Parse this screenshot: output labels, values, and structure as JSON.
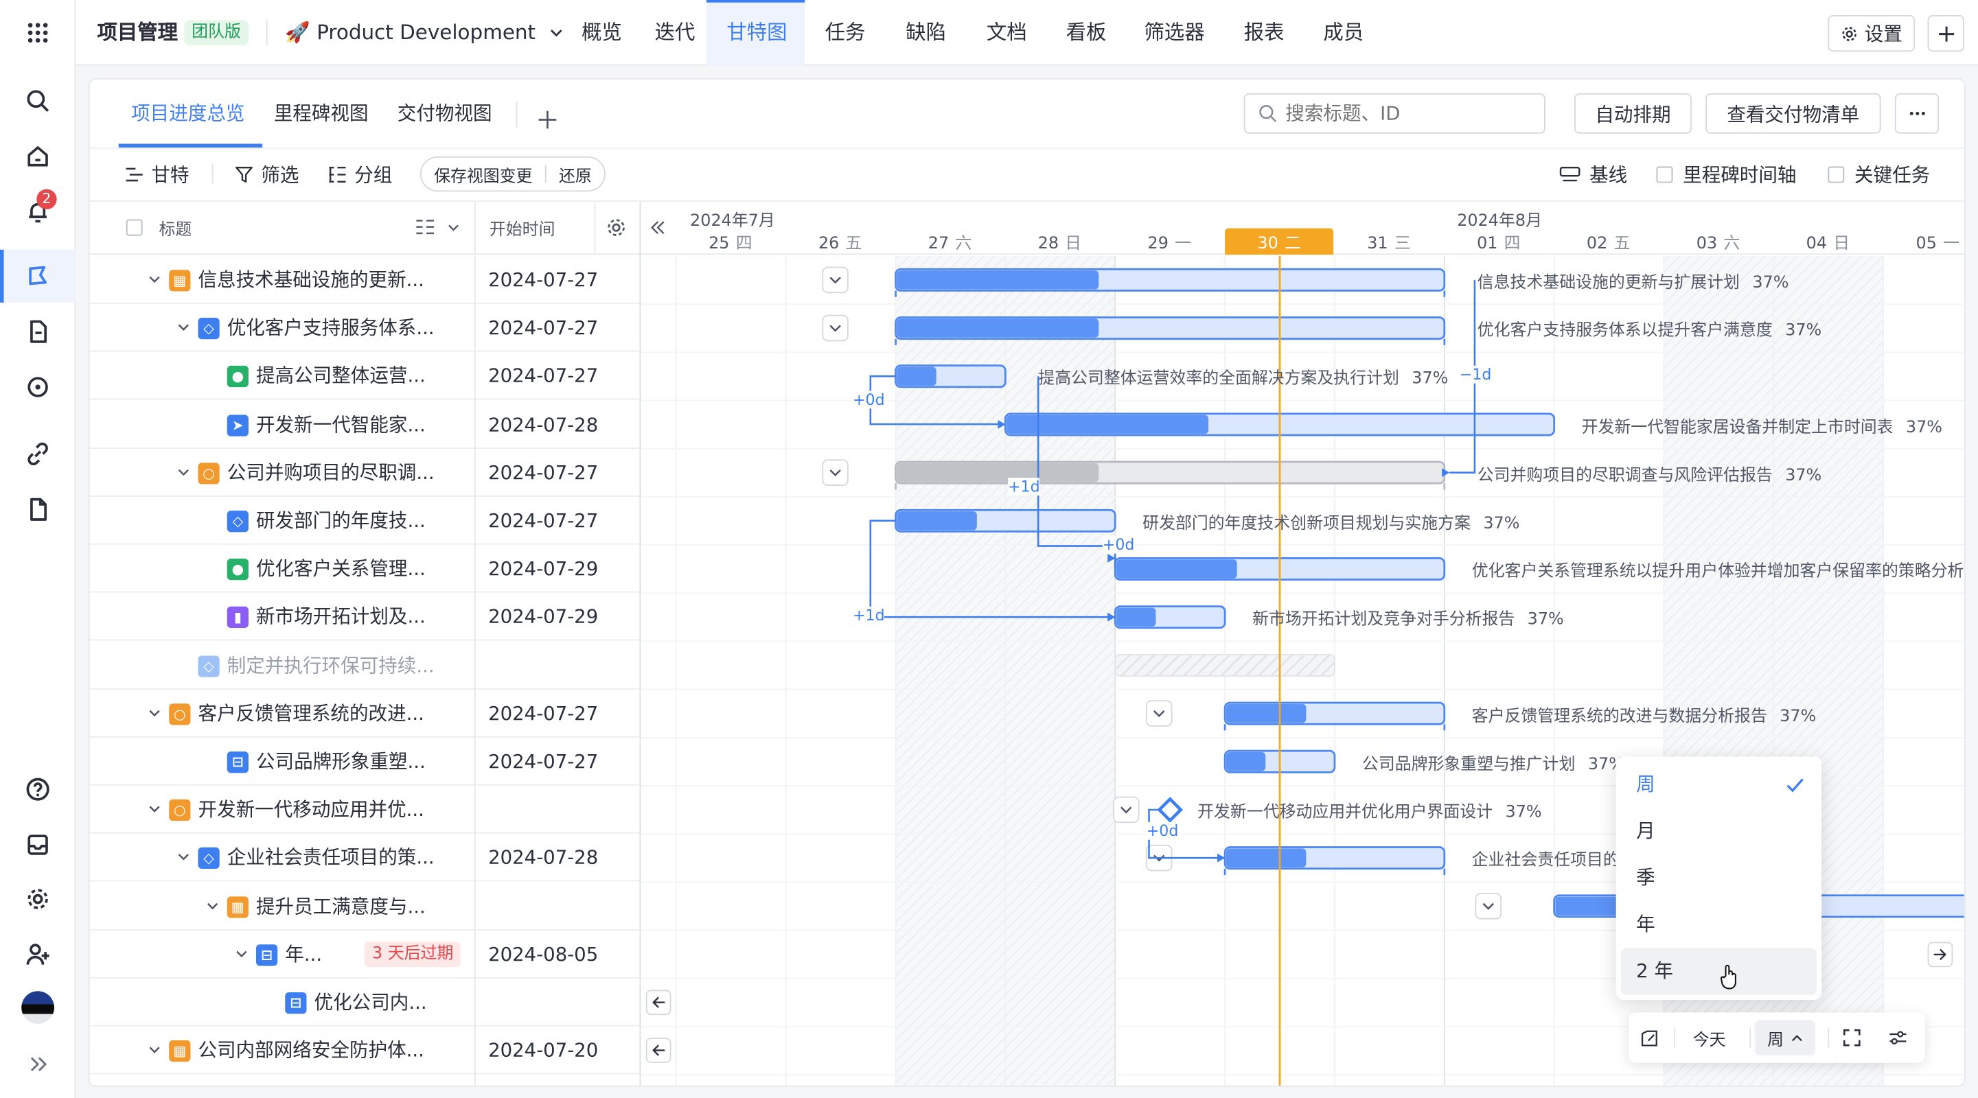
{
  "topbar": {
    "project_label": "项目管理",
    "edition_badge": "团队版",
    "project_name": "🚀 Product Development",
    "nav": [
      "概览",
      "迭代",
      "甘特图",
      "任务",
      "缺陷",
      "文档",
      "看板",
      "筛选器",
      "报表",
      "成员"
    ],
    "active_nav": "甘特图",
    "settings_label": "设置"
  },
  "rail": {
    "notification_count": "2"
  },
  "views": {
    "tabs": [
      "项目进度总览",
      "里程碑视图",
      "交付物视图"
    ],
    "active": "项目进度总览",
    "search_placeholder": "搜索标题、ID",
    "auto_schedule": "自动排期",
    "view_deliverables": "查看交付物清单"
  },
  "toolbar": {
    "gantt": "甘特",
    "filter": "筛选",
    "group": "分组",
    "save_view": "保存视图变更",
    "restore": "还原",
    "baseline": "基线",
    "milestone_axis": "里程碑时间轴",
    "critical_task": "关键任务"
  },
  "columns": {
    "title": "标题",
    "start": "开始时间"
  },
  "timeline": {
    "month1": "2024年7月",
    "month2": "2024年8月",
    "days": [
      {
        "d": "25",
        "w": "四"
      },
      {
        "d": "26",
        "w": "五"
      },
      {
        "d": "27",
        "w": "六"
      },
      {
        "d": "28",
        "w": "日"
      },
      {
        "d": "29",
        "w": "一"
      },
      {
        "d": "30",
        "w": "二"
      },
      {
        "d": "31",
        "w": "三"
      },
      {
        "d": "01",
        "w": "四"
      },
      {
        "d": "02",
        "w": "五"
      },
      {
        "d": "03",
        "w": "六"
      },
      {
        "d": "04",
        "w": "日"
      },
      {
        "d": "05",
        "w": "一"
      }
    ],
    "today_index": 5
  },
  "rows": [
    {
      "title": "信息技术基础设施的更新...",
      "date": "2024-07-27",
      "level": 0,
      "icon": "epic",
      "color": "#f29a2e",
      "expand": true
    },
    {
      "title": "优化客户支持服务体系...",
      "date": "2024-07-27",
      "level": 1,
      "icon": "feature",
      "color": "#3d7ef0",
      "expand": true
    },
    {
      "title": "提高公司整体运营...",
      "date": "2024-07-27",
      "level": 2,
      "icon": "user-story",
      "color": "#27b26a",
      "expand": false
    },
    {
      "title": "开发新一代智能家...",
      "date": "2024-07-28",
      "level": 2,
      "icon": "task",
      "color": "#3d7ef0",
      "expand": false
    },
    {
      "title": "公司并购项目的尽职调...",
      "date": "2024-07-27",
      "level": 1,
      "icon": "idea",
      "color": "#f29a2e",
      "expand": true
    },
    {
      "title": "研发部门的年度技...",
      "date": "2024-07-27",
      "level": 2,
      "icon": "feature",
      "color": "#3d7ef0",
      "expand": false
    },
    {
      "title": "优化客户关系管理...",
      "date": "2024-07-29",
      "level": 2,
      "icon": "user-story",
      "color": "#27b26a",
      "expand": false
    },
    {
      "title": "新市场开拓计划及...",
      "date": "2024-07-29",
      "level": 2,
      "icon": "bookmark",
      "color": "#8b5cf6",
      "expand": false
    },
    {
      "title": "制定并执行环保可持续...",
      "date": "",
      "level": 1,
      "icon": "feature",
      "color": "#9ec1f7",
      "expand": false,
      "muted": true
    },
    {
      "title": "客户反馈管理系统的改进...",
      "date": "2024-07-27",
      "level": 0,
      "icon": "idea",
      "color": "#f29a2e",
      "expand": true
    },
    {
      "title": "公司品牌形象重塑...",
      "date": "2024-07-27",
      "level": 2,
      "icon": "sub-task",
      "color": "#3d7ef0",
      "expand": false
    },
    {
      "title": "开发新一代移动应用并优...",
      "date": "",
      "level": 0,
      "icon": "idea",
      "color": "#f29a2e",
      "expand": true
    },
    {
      "title": "企业社会责任项目的策...",
      "date": "2024-07-28",
      "level": 1,
      "icon": "feature",
      "color": "#3d7ef0",
      "expand": true
    },
    {
      "title": "提升员工满意度与...",
      "date": "",
      "level": 2,
      "icon": "epic",
      "color": "#f29a2e",
      "expand": true
    },
    {
      "title": "年...",
      "date": "2024-08-05",
      "level": 3,
      "icon": "sub-task",
      "color": "#3d7ef0",
      "expand": true,
      "overdue": "3 天后过期"
    },
    {
      "title": "优化公司内...",
      "date": "",
      "level": 4,
      "icon": "sub-task",
      "color": "#3d7ef0",
      "expand": false
    },
    {
      "title": "公司内部网络安全防护体...",
      "date": "2024-07-20",
      "level": 0,
      "icon": "epic",
      "color": "#f29a2e",
      "expand": true
    }
  ],
  "gantt_labels": [
    {
      "text": "信息技术基础设施的更新与扩展计划",
      "pct": "37%"
    },
    {
      "text": "优化客户支持服务体系以提升客户满意度",
      "pct": "37%"
    },
    {
      "text": "提高公司整体运营效率的全面解决方案及执行计划",
      "pct": "37%"
    },
    {
      "text": "开发新一代智能家居设备并制定上市时间表",
      "pct": "37%"
    },
    {
      "text": "公司并购项目的尽职调查与风险评估报告",
      "pct": "37%"
    },
    {
      "text": "研发部门的年度技术创新项目规划与实施方案",
      "pct": "37%"
    },
    {
      "text": "优化客户关系管理系统以提升用户体验并增加客户保留率的策略分析",
      "pct": ""
    },
    {
      "text": "新市场开拓计划及竞争对手分析报告",
      "pct": "37%"
    },
    {
      "text": "客户反馈管理系统的改进与数据分析报告",
      "pct": "37%"
    },
    {
      "text": "公司品牌形象重塑与推广计划",
      "pct": "37%"
    },
    {
      "text": "开发新一代移动应用并优化用户界面设计",
      "pct": "37%"
    },
    {
      "text": "企业社会责任项目的",
      "pct": ""
    }
  ],
  "progress": 0.37,
  "dep_labels": {
    "a": "+0d",
    "b": "−1d",
    "c": "+1d",
    "d": "+0d",
    "e": "+1d",
    "f": "+0d"
  },
  "scale_dropdown": {
    "options": [
      "周",
      "月",
      "季",
      "年",
      "2 年"
    ],
    "selected": "周",
    "hovered": "2 年"
  },
  "bottom_toolbar": {
    "today": "今天",
    "scale": "周"
  }
}
